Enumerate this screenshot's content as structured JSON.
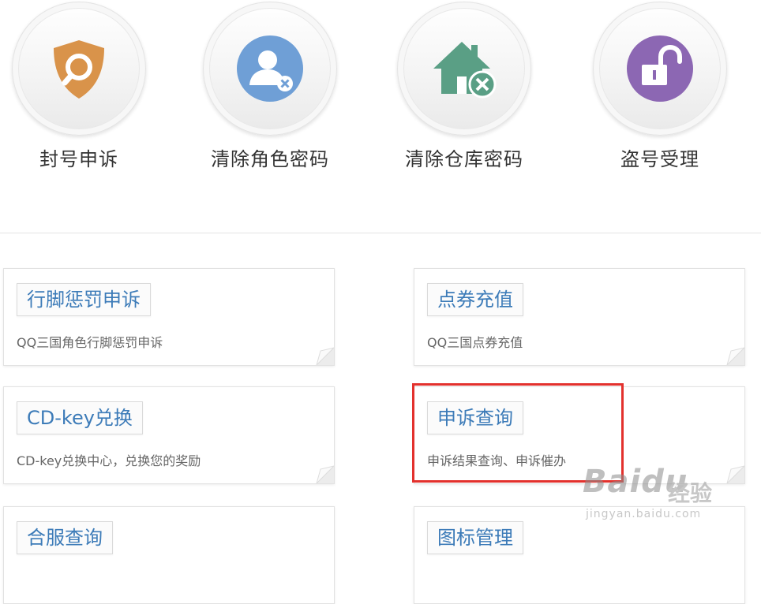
{
  "quick_actions": [
    {
      "label": "封号申诉",
      "icon": "shield-search-icon",
      "color": "#d9934a"
    },
    {
      "label": "清除角色密码",
      "icon": "user-remove-icon",
      "color": "#6f9fd6"
    },
    {
      "label": "清除仓库密码",
      "icon": "house-remove-icon",
      "color": "#5a9f85"
    },
    {
      "label": "盗号受理",
      "icon": "unlock-icon",
      "color": "#8c67b3"
    }
  ],
  "services": [
    {
      "title": "行脚惩罚申诉",
      "desc": "QQ三国角色行脚惩罚申诉"
    },
    {
      "title": "点券充值",
      "desc": "QQ三国点券充值"
    },
    {
      "title": "CD-key兑换",
      "desc": "CD-key兑换中心，兑换您的奖励"
    },
    {
      "title": "申诉查询",
      "desc": "申诉结果查询、申诉催办"
    },
    {
      "title": "合服查询",
      "desc": ""
    },
    {
      "title": "图标管理",
      "desc": ""
    }
  ],
  "watermark": {
    "logo": "Baidu",
    "cn": "经验",
    "url": "jingyan.baidu.com"
  },
  "colors": {
    "link_blue": "#3c7bb8",
    "highlight_red": "#e3312d"
  }
}
